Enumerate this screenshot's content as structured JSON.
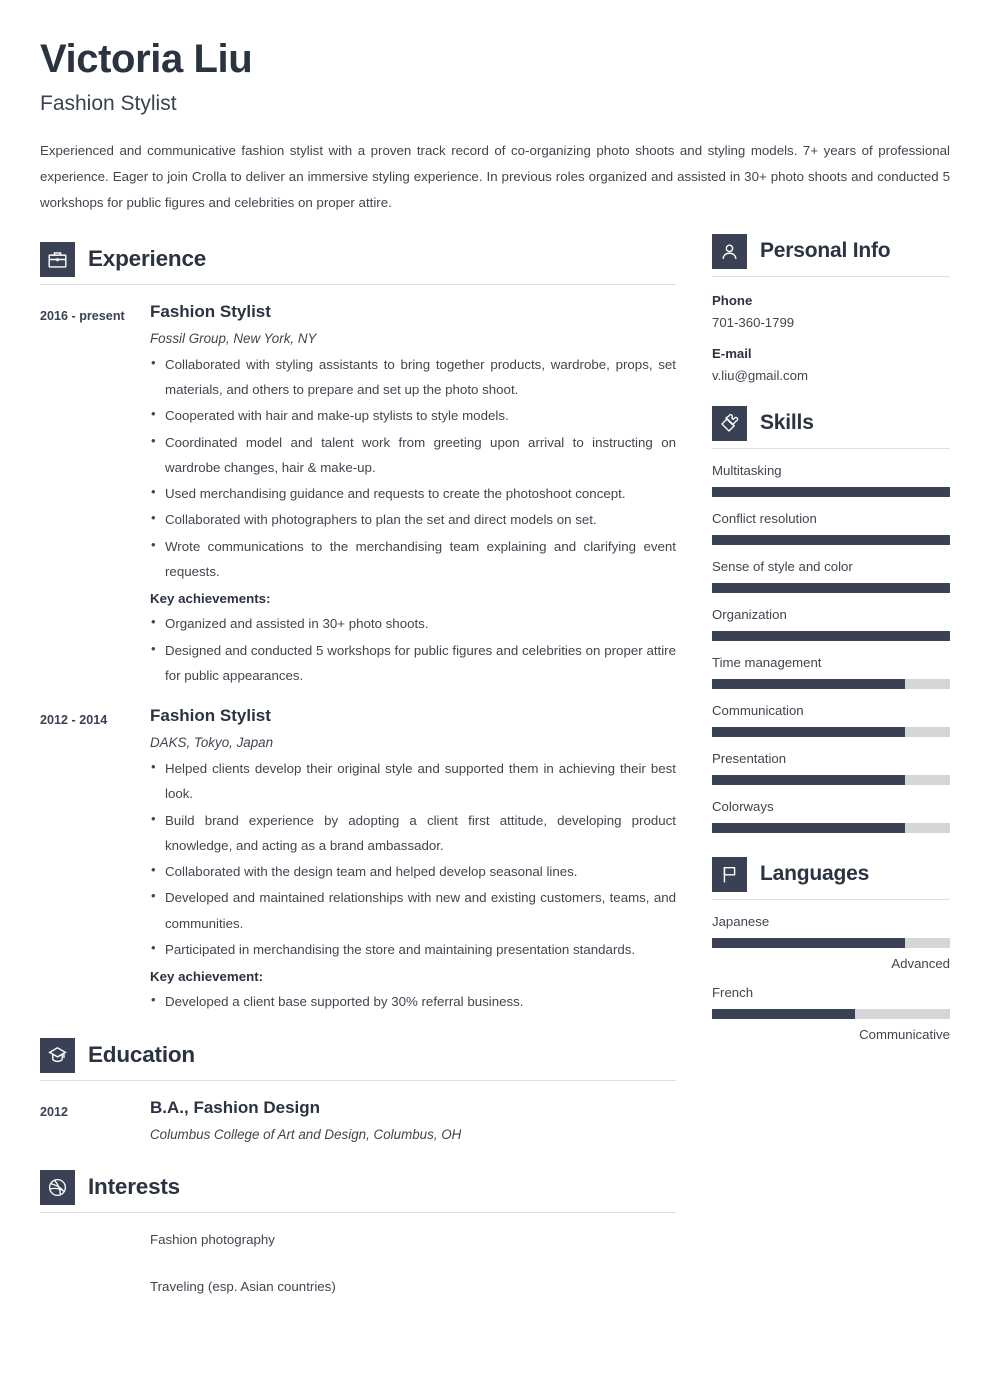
{
  "header": {
    "name": "Victoria Liu",
    "job_title": "Fashion Stylist",
    "summary": "Experienced and communicative fashion stylist with a proven track record of co-organizing photo shoots and styling models. 7+ years of professional experience. Eager to join Crolla to deliver an immersive styling experience. In previous roles organized and assisted in 30+ photo shoots and conducted 5 workshops for public figures and celebrities on proper attire."
  },
  "sections": {
    "experience": {
      "title": "Experience",
      "icon": "briefcase-icon"
    },
    "education": {
      "title": "Education",
      "icon": "graduation-cap-icon"
    },
    "interests": {
      "title": "Interests",
      "icon": "dribbble-ball-icon"
    },
    "personal_info": {
      "title": "Personal Info",
      "icon": "user-icon"
    },
    "skills": {
      "title": "Skills",
      "icon": "puzzle-piece-icon"
    },
    "languages": {
      "title": "Languages",
      "icon": "flag-icon"
    }
  },
  "experience": [
    {
      "date": "2016 - present",
      "title": "Fashion Stylist",
      "company": "Fossil Group, New York, NY",
      "bullets": [
        "Collaborated with styling assistants to bring together products, wardrobe, props, set materials, and others to prepare and set up the photo shoot.",
        "Cooperated with hair and make-up stylists to style models.",
        "Coordinated model and talent work from greeting upon arrival to instructing on wardrobe changes, hair & make-up.",
        "Used merchandising guidance and requests to create the photoshoot concept.",
        "Collaborated with photographers to plan the set and direct models on set.",
        "Wrote communications to the merchandising team explaining and clarifying event requests."
      ],
      "achievements_label": "Key achievements:",
      "achievements": [
        "Organized and assisted in 30+ photo shoots.",
        "Designed and conducted 5 workshops for public figures and celebrities on proper attire for public appearances."
      ]
    },
    {
      "date": "2012 - 2014",
      "title": "Fashion Stylist",
      "company": "DAKS, Tokyo, Japan",
      "bullets": [
        "Helped clients develop their original style and supported them in achieving their best look.",
        "Build brand experience by adopting a client first attitude, developing product knowledge, and acting as a brand ambassador.",
        "Collaborated with the design team and helped develop seasonal lines.",
        "Developed and maintained relationships with new and existing customers, teams, and communities.",
        "Participated in merchandising the store and maintaining presentation standards."
      ],
      "achievements_label": "Key achievement:",
      "achievements": [
        "Developed a client base supported by 30% referral business."
      ]
    }
  ],
  "education": [
    {
      "date": "2012",
      "degree": "B.A., Fashion Design",
      "school": "Columbus College of Art and Design, Columbus, OH"
    }
  ],
  "interests": [
    "Fashion photography",
    "Traveling (esp. Asian countries)"
  ],
  "personal_info": [
    {
      "label": "Phone",
      "value": "701-360-1799"
    },
    {
      "label": "E-mail",
      "value": "v.liu@gmail.com"
    }
  ],
  "skills": [
    {
      "name": "Multitasking",
      "level": 100
    },
    {
      "name": "Conflict resolution",
      "level": 100
    },
    {
      "name": "Sense of style and color",
      "level": 100
    },
    {
      "name": "Organization",
      "level": 100
    },
    {
      "name": "Time management",
      "level": 81
    },
    {
      "name": "Communication",
      "level": 81
    },
    {
      "name": "Presentation",
      "level": 81
    },
    {
      "name": "Colorways",
      "level": 81
    }
  ],
  "languages": [
    {
      "name": "Japanese",
      "level": 81,
      "proficiency": "Advanced"
    },
    {
      "name": "French",
      "level": 60,
      "proficiency": "Communicative"
    }
  ],
  "colors": {
    "accent_dark": "#3a4154",
    "heading": "#2b3240",
    "text": "#40464f",
    "bar_track": "#d4d6d8",
    "rule": "#dcdee2"
  }
}
